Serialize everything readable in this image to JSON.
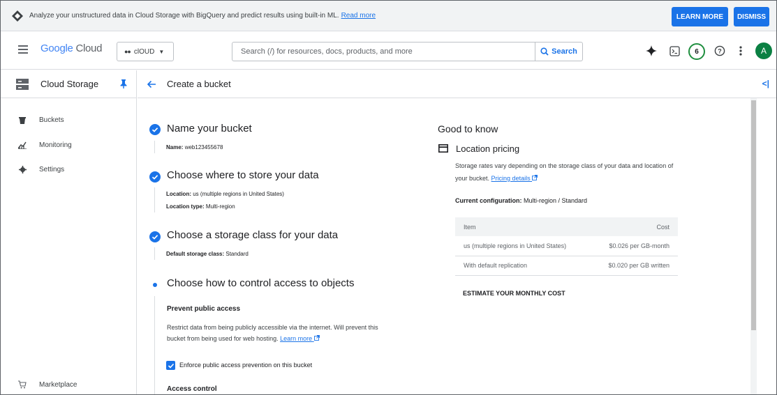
{
  "banner": {
    "text": "Analyze your unstructured data in Cloud Storage with BigQuery and predict results using built-in ML.",
    "link": "Read more",
    "learn_more": "LEARN MORE",
    "dismiss": "DISMISS"
  },
  "header": {
    "logo_google": "Google",
    "logo_cloud": "Cloud",
    "project": "clOUD",
    "search_placeholder": "Search (/) for resources, docs, products, and more",
    "search_button": "Search",
    "notifications_count": "6",
    "avatar_letter": "A"
  },
  "sidebar": {
    "title": "Cloud Storage",
    "items": [
      {
        "label": "Buckets",
        "icon": "bucket-icon"
      },
      {
        "label": "Monitoring",
        "icon": "monitoring-icon"
      },
      {
        "label": "Settings",
        "icon": "gear-icon"
      }
    ],
    "bottom_item": {
      "label": "Marketplace",
      "icon": "cart-icon"
    }
  },
  "main": {
    "title": "Create a bucket",
    "steps": [
      {
        "title": "Name your bucket",
        "details": [
          {
            "key": "Name:",
            "value": "web123455678"
          }
        ]
      },
      {
        "title": "Choose where to store your data",
        "details": [
          {
            "key": "Location:",
            "value": "us (multiple regions in United States)"
          },
          {
            "key": "Location type:",
            "value": "Multi-region"
          }
        ]
      },
      {
        "title": "Choose a storage class for your data",
        "details": [
          {
            "key": "Default storage class:",
            "value": "Standard"
          }
        ]
      },
      {
        "title": "Choose how to control access to objects"
      }
    ],
    "prevent_public": {
      "heading": "Prevent public access",
      "text": "Restrict data from being publicly accessible via the internet. Will prevent this bucket from being used for web hosting.",
      "link": "Learn more",
      "checkbox_label": "Enforce public access prevention on this bucket",
      "checked": true
    },
    "access_control_heading": "Access control"
  },
  "good_to_know": {
    "title": "Good to know",
    "pricing_title": "Location pricing",
    "pricing_text": "Storage rates vary depending on the storage class of your data and location of your bucket.",
    "pricing_link": "Pricing details",
    "current_config_label": "Current configuration:",
    "current_config_value": "Multi-region / Standard",
    "table": {
      "headers": [
        "Item",
        "Cost"
      ],
      "rows": [
        [
          "us (multiple regions in United States)",
          "$0.026 per GB-month"
        ],
        [
          "With default replication",
          "$0.020 per GB written"
        ]
      ]
    },
    "estimate": "ESTIMATE YOUR MONTHLY COST"
  },
  "colors": {
    "accent": "#1a73e8",
    "avatar": "#0b8043",
    "notif_ring": "#1e8e3e"
  }
}
